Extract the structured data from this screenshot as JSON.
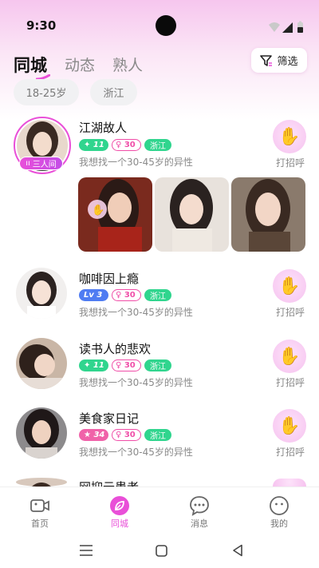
{
  "status_bar": {
    "time": "9:30"
  },
  "tabs": [
    {
      "label": "同城",
      "active": true
    },
    {
      "label": "动态",
      "active": false
    },
    {
      "label": "熟人",
      "active": false
    }
  ],
  "filter": {
    "label": "筛选",
    "icon": "filter-icon"
  },
  "chips": [
    "18-25岁",
    "浙江"
  ],
  "users": [
    {
      "name": "江湖故人",
      "level": "11",
      "level_color": "#30d58e",
      "age": "30",
      "location": "浙江",
      "desc": "我想找一个30-45岁的异性",
      "wave_label": "打招呼",
      "room_badge": "三人间"
    },
    {
      "name": "咖啡因上瘾",
      "level": "Lv 3",
      "level_color": "#4f7cf2",
      "age": "30",
      "location": "浙江",
      "desc": "我想找一个30-45岁的异性",
      "wave_label": "打招呼"
    },
    {
      "name": "读书人的悲欢",
      "level": "11",
      "level_color": "#30d58e",
      "age": "30",
      "location": "浙江",
      "desc": "我想找一个30-45岁的异性",
      "wave_label": "打招呼"
    },
    {
      "name": "美食家日记",
      "level": "34",
      "level_color": "#f062a9",
      "age": "30",
      "location": "浙江",
      "desc": "我想找一个30-45岁的异性",
      "wave_label": "打招呼"
    },
    {
      "name": "网抑云患者"
    }
  ],
  "nav": [
    {
      "label": "首页",
      "icon": "video-icon",
      "active": false
    },
    {
      "label": "同城",
      "icon": "leaf-icon",
      "active": true
    },
    {
      "label": "消息",
      "icon": "chat-icon",
      "active": false
    },
    {
      "label": "我的",
      "icon": "smile-icon",
      "active": false
    }
  ],
  "colors": {
    "accent": "#e94fd8",
    "green": "#30d58e",
    "blue": "#4f7cf2",
    "pink": "#f062a9"
  }
}
